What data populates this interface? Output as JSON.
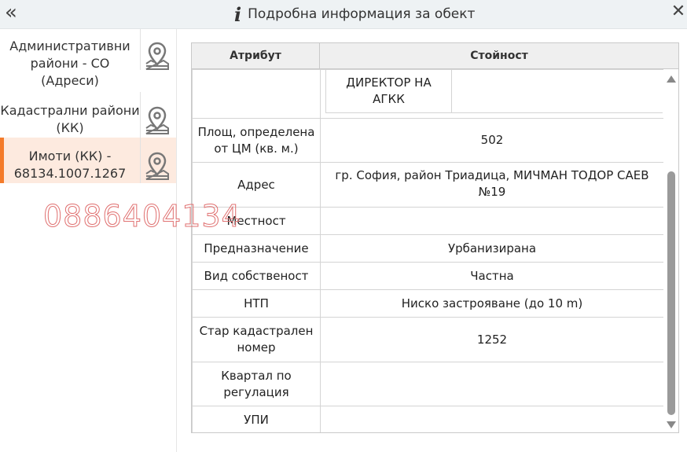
{
  "header": {
    "collapse_label": "«",
    "title": "Подробна информация за обект",
    "close_label": "✕"
  },
  "sidebar": {
    "items": [
      {
        "label": "Административни райони - СО (Адреси)",
        "icon": "map-pin-icon",
        "active": false
      },
      {
        "label": "Кадастрални райони (КК)",
        "icon": "map-pin-icon",
        "active": false
      },
      {
        "label": "Имоти (КК) - 68134.1007.1267",
        "icon": "map-pin-icon",
        "active": true
      }
    ],
    "accent_color": "#f47b2a"
  },
  "watermark": "0886404134",
  "table": {
    "headers": {
      "attribute": "Атрибут",
      "value": "Стойност"
    },
    "nested_value": "ДИРЕКТОР НА АГКК",
    "rows": [
      {
        "attribute": "Площ, определена от ЦМ (кв. м.)",
        "value": "502"
      },
      {
        "attribute": "Адрес",
        "value": "гр. София, район Триадица, МИЧМАН ТОДОР САЕВ №19"
      },
      {
        "attribute": "Местност",
        "value": ""
      },
      {
        "attribute": "Предназначение",
        "value": "Урбанизирана"
      },
      {
        "attribute": "Вид собственост",
        "value": "Частна"
      },
      {
        "attribute": "НТП",
        "value": "Ниско застрояване (до 10 m)"
      },
      {
        "attribute": "Стар кадастрален номер",
        "value": "1252"
      },
      {
        "attribute": "Квартал по регулация",
        "value": ""
      },
      {
        "attribute": "УПИ",
        "value": ""
      }
    ]
  }
}
